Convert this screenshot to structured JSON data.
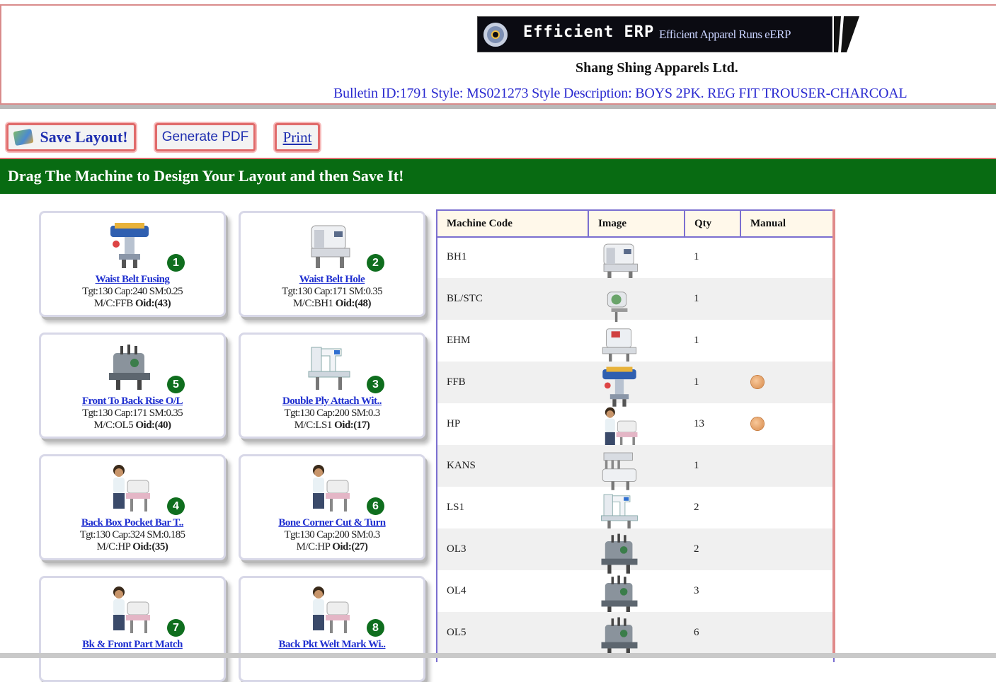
{
  "header": {
    "logo_title": "Efficient ERP",
    "logo_tagline": "Efficient Apparel Runs eERP",
    "company": "Shang Shing Apparels Ltd.",
    "bulletin": "Bulletin ID:1791 Style: MS021273 Style Description: BOYS 2PK. REG FIT TROUSER-CHARCOAL"
  },
  "toolbar": {
    "save_label": "Save Layout!",
    "pdf_label": "Generate PDF",
    "print_label": "Print"
  },
  "instruction": "Drag The Machine to Design Your Layout and then Save It!",
  "cards": [
    {
      "num": "1",
      "name": "Waist Belt Fusing",
      "stats": "Tgt:130 Cap:240 SM:0.25",
      "mc": "M/C:FFB",
      "oid": "Oid:(43)",
      "art": "press-machine"
    },
    {
      "num": "2",
      "name": "Waist Belt Hole",
      "stats": "Tgt:130 Cap:171 SM:0.35",
      "mc": "M/C:BH1",
      "oid": "Oid:(48)",
      "art": "buttonhole-machine"
    },
    {
      "num": "5",
      "name": "Front To Back Rise O/L",
      "stats": "Tgt:130 Cap:171 SM:0.35",
      "mc": "M/C:OL5",
      "oid": "Oid:(40)",
      "art": "overlock-machine"
    },
    {
      "num": "3",
      "name": "Double Ply Attach Wit..",
      "stats": "Tgt:130 Cap:200 SM:0.3",
      "mc": "M/C:LS1",
      "oid": "Oid:(17)",
      "art": "lockstitch-machine"
    },
    {
      "num": "4",
      "name": "Back Box Pocket Bar T..",
      "stats": "Tgt:130 Cap:324 SM:0.185",
      "mc": "M/C:HP",
      "oid": "Oid:(35)",
      "art": "helper-person"
    },
    {
      "num": "6",
      "name": "Bone Corner Cut & Turn",
      "stats": "Tgt:130 Cap:200 SM:0.3",
      "mc": "M/C:HP",
      "oid": "Oid:(27)",
      "art": "helper-person"
    },
    {
      "num": "7",
      "name": "Bk & Front Part Match",
      "stats": "",
      "mc": "",
      "oid": "",
      "art": "helper-person"
    },
    {
      "num": "8",
      "name": "Back Pkt Welt Mark Wi..",
      "stats": "",
      "mc": "",
      "oid": "",
      "art": "helper-person"
    }
  ],
  "table": {
    "headers": [
      "Machine Code",
      "Image",
      "Qty",
      "Manual"
    ],
    "rows": [
      {
        "code": "BH1",
        "qty": "1",
        "manual": false,
        "art": "buttonhole-machine"
      },
      {
        "code": "BL/STC",
        "qty": "1",
        "manual": false,
        "art": "blindstitch-machine"
      },
      {
        "code": "EHM",
        "qty": "1",
        "manual": false,
        "art": "eyelet-machine"
      },
      {
        "code": "FFB",
        "qty": "1",
        "manual": true,
        "art": "press-machine"
      },
      {
        "code": "HP",
        "qty": "13",
        "manual": true,
        "art": "helper-person"
      },
      {
        "code": "KANS",
        "qty": "1",
        "manual": false,
        "art": "kansai-machine"
      },
      {
        "code": "LS1",
        "qty": "2",
        "manual": false,
        "art": "lockstitch-machine"
      },
      {
        "code": "OL3",
        "qty": "2",
        "manual": false,
        "art": "overlock-machine"
      },
      {
        "code": "OL4",
        "qty": "3",
        "manual": false,
        "art": "overlock-machine"
      },
      {
        "code": "OL5",
        "qty": "6",
        "manual": false,
        "art": "overlock-machine"
      }
    ]
  }
}
